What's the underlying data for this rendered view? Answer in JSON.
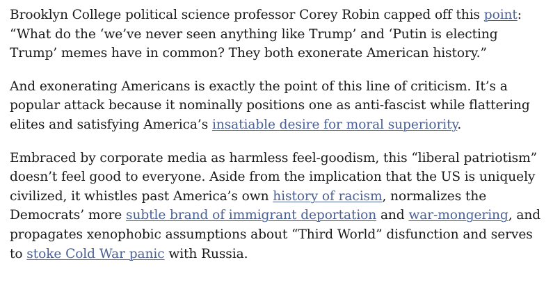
{
  "paragraphs": [
    {
      "segments": [
        {
          "text": "Brooklyn College political science professor Corey Robin capped off this "
        },
        {
          "text": "point",
          "link": true
        },
        {
          "text": ": “What do the ‘we’ve never seen anything like Trump’ and ‘Putin is electing Trump’ memes have in common? They both exonerate American history.”"
        }
      ]
    },
    {
      "segments": [
        {
          "text": "And exonerating Americans is exactly the point of this line of criticism. It’s a popular attack because it nominally positions one as anti-fascist while flattering elites and satisfying America’s "
        },
        {
          "text": "insatiable desire for moral superiority",
          "link": true
        },
        {
          "text": "."
        }
      ]
    },
    {
      "segments": [
        {
          "text": "Embraced by corporate media as harmless feel-goodism, this “liberal patriotism” doesn’t feel good to everyone. Aside from the implication that the US is uniquely civilized, it whistles past America’s own "
        },
        {
          "text": "history of racism",
          "link": true
        },
        {
          "text": ", normalizes the Democrats’ more "
        },
        {
          "text": "subtle brand of immigrant deportation",
          "link": true
        },
        {
          "text": " and "
        },
        {
          "text": "war-mongering",
          "link": true
        },
        {
          "text": ", and propagates xenophobic assumptions about “Third World” disfunction and serves to "
        },
        {
          "text": "stoke Cold War panic",
          "link": true
        },
        {
          "text": " with Russia."
        }
      ]
    }
  ],
  "colors": {
    "text": "#1a1a1a",
    "link": "#4a5f92",
    "background": "#ffffff"
  }
}
